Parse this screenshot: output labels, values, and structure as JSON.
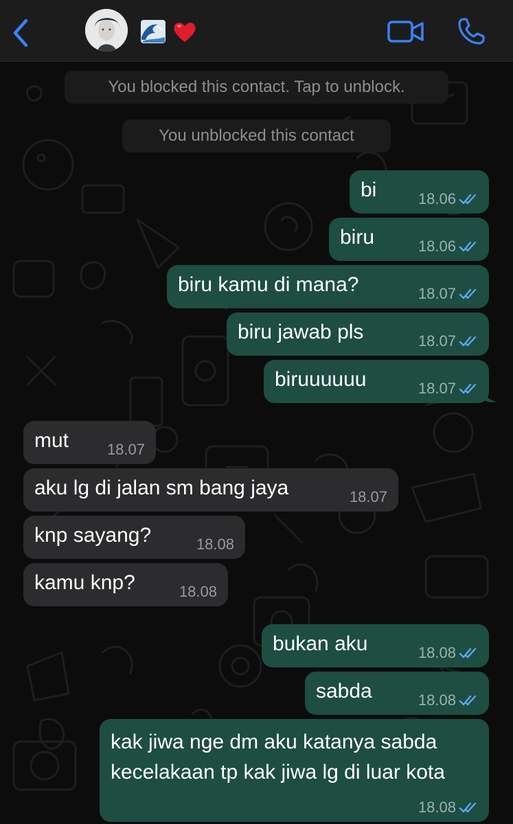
{
  "header": {
    "back_icon": "chevron-left-icon",
    "contact_emojis": [
      "wave-emoji",
      "red-heart-emoji"
    ],
    "video_icon": "video-camera-icon",
    "call_icon": "phone-icon",
    "accent": "#3a82f6"
  },
  "system_messages": [
    "You blocked this contact. Tap to unblock.",
    "You unblocked this contact"
  ],
  "messages": [
    {
      "dir": "out",
      "text": "bi",
      "time": "18.06"
    },
    {
      "dir": "out",
      "text": "biru",
      "time": "18.06"
    },
    {
      "dir": "out",
      "text": "biru kamu di mana?",
      "time": "18.07"
    },
    {
      "dir": "out",
      "text": "biru jawab pls",
      "time": "18.07"
    },
    {
      "dir": "out",
      "text": "biruuuuuu",
      "time": "18.07"
    },
    {
      "dir": "in",
      "text": "mut",
      "time": "18.07"
    },
    {
      "dir": "in",
      "text": "aku lg di jalan sm bang jaya",
      "time": "18.07"
    },
    {
      "dir": "in",
      "text": "knp sayang?",
      "time": "18.08"
    },
    {
      "dir": "in",
      "text": "kamu knp?",
      "time": "18.08"
    },
    {
      "dir": "out",
      "text": "bukan aku",
      "time": "18.08"
    },
    {
      "dir": "out",
      "text": "sabda",
      "time": "18.08"
    },
    {
      "dir": "out",
      "text": "kak jiwa nge dm aku katanya sabda kecelakaan tp kak jiwa lg di luar kota",
      "time": "18.08"
    }
  ],
  "colors": {
    "outgoing_bubble": "#1e4d42",
    "incoming_bubble": "#2c2c2e",
    "read_ticks": "#5aa9f0",
    "header_bg": "#1c1c1d"
  }
}
